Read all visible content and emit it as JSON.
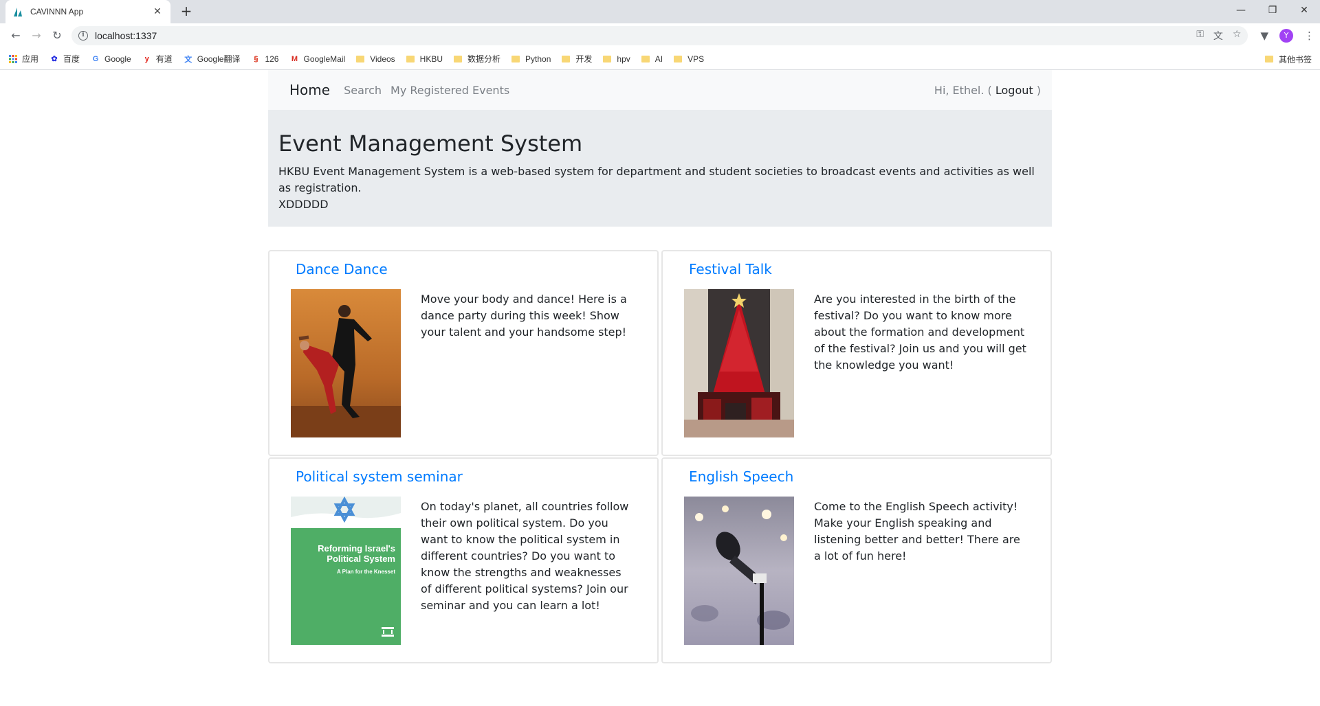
{
  "browser": {
    "tab_title": "CAVINNN App",
    "url": "localhost:1337",
    "profile_initial": "Y",
    "bookmarks": [
      {
        "label": "应用",
        "icon": "apps-grid-icon"
      },
      {
        "label": "百度",
        "icon": "baidu-paw-icon"
      },
      {
        "label": "Google",
        "icon": "google-g-icon"
      },
      {
        "label": "有道",
        "icon": "youdao-icon"
      },
      {
        "label": "Google翻译",
        "icon": "google-translate-icon"
      },
      {
        "label": "126",
        "icon": "netease-126-icon"
      },
      {
        "label": "GoogleMail",
        "icon": "gmail-icon"
      },
      {
        "label": "Videos",
        "icon": "folder-icon"
      },
      {
        "label": "HKBU",
        "icon": "folder-icon"
      },
      {
        "label": "数据分析",
        "icon": "folder-icon"
      },
      {
        "label": "Python",
        "icon": "folder-icon"
      },
      {
        "label": "开发",
        "icon": "folder-icon"
      },
      {
        "label": "hpv",
        "icon": "folder-icon"
      },
      {
        "label": "AI",
        "icon": "folder-icon"
      },
      {
        "label": "VPS",
        "icon": "folder-icon"
      }
    ],
    "other_bookmarks": "其他书签"
  },
  "nav": {
    "brand": "Home",
    "links": [
      "Search",
      "My Registered Events"
    ],
    "greeting_prefix": "Hi, Ethel. (",
    "logout": "Logout",
    "greeting_suffix": ")"
  },
  "jumbotron": {
    "title": "Event Management System",
    "description": "HKBU Event Management System is a web-based system for department and student societies to broadcast events and activities as well as registration.",
    "extra": "XDDDDD"
  },
  "events": [
    {
      "title": "Dance Dance",
      "image": "dance-photo",
      "description": "Move your body and dance! Here is a dance party during this week! Show your talent and your handsome step!"
    },
    {
      "title": "Festival Talk",
      "image": "christmas-tree-photo",
      "description": "Are you interested in the birth of the festival? Do you want to know more about the formation and development of the festival? Join us and you will get the knowledge you want!"
    },
    {
      "title": "Political system seminar",
      "image": "book-cover",
      "description": "On today's planet, all countries follow their own political system. Do you want to know the political system in different countries? Do you want to know the strengths and weaknesses of different political systems? Join our seminar and you can learn a lot!",
      "cover_title_line1": "Reforming Israel's",
      "cover_title_line2": "Political System",
      "cover_subtitle": "A Plan for the Knesset"
    },
    {
      "title": "English Speech",
      "image": "microphone-photo",
      "description": "Come to the English Speech activity! Make your English speaking and listening better and better! There are a lot of fun here!"
    }
  ]
}
